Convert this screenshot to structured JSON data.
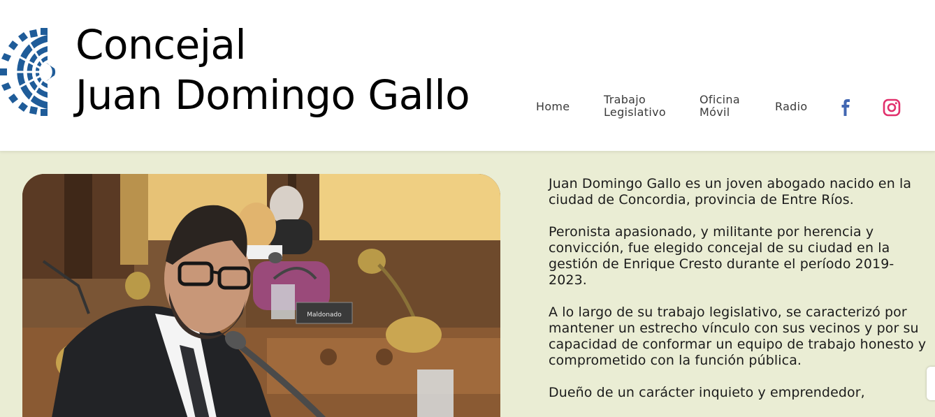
{
  "site": {
    "title_line1": "Concejal",
    "title_line2": "Juan Domingo Gallo",
    "logo_icon": "parliament-gear-icon",
    "brand_color": "#1f5c99"
  },
  "nav": {
    "items": [
      {
        "label": "Home"
      },
      {
        "label_line1": "Trabajo",
        "label_line2": "Legislativo"
      },
      {
        "label_line1": "Oficina",
        "label_line2": "Móvil"
      },
      {
        "label": "Radio"
      }
    ],
    "social": [
      {
        "icon": "facebook-icon",
        "color": "#4267b2"
      },
      {
        "icon": "instagram-icon",
        "color": "#e1306c"
      }
    ]
  },
  "main": {
    "photo_nameplate": "Maldonado",
    "bio": [
      "Juan Domingo Gallo es un joven abogado nacido en la ciudad de Concordia, provincia de Entre Ríos.",
      "Peronista apasionado, y militante por herencia y convicción, fue elegido concejal de su ciudad en la gestión de Enrique Cresto durante el período 2019-2023.",
      "A lo largo de su trabajo legislativo, se caracterizó por mantener un estrecho vínculo con sus vecinos y por su capacidad de conformar un equipo de trabajo honesto y comprometido con la función pública.",
      "Dueño de un carácter inquieto y emprendedor,"
    ]
  },
  "colors": {
    "page_background": "#eaedd4",
    "header_background": "#ffffff"
  }
}
